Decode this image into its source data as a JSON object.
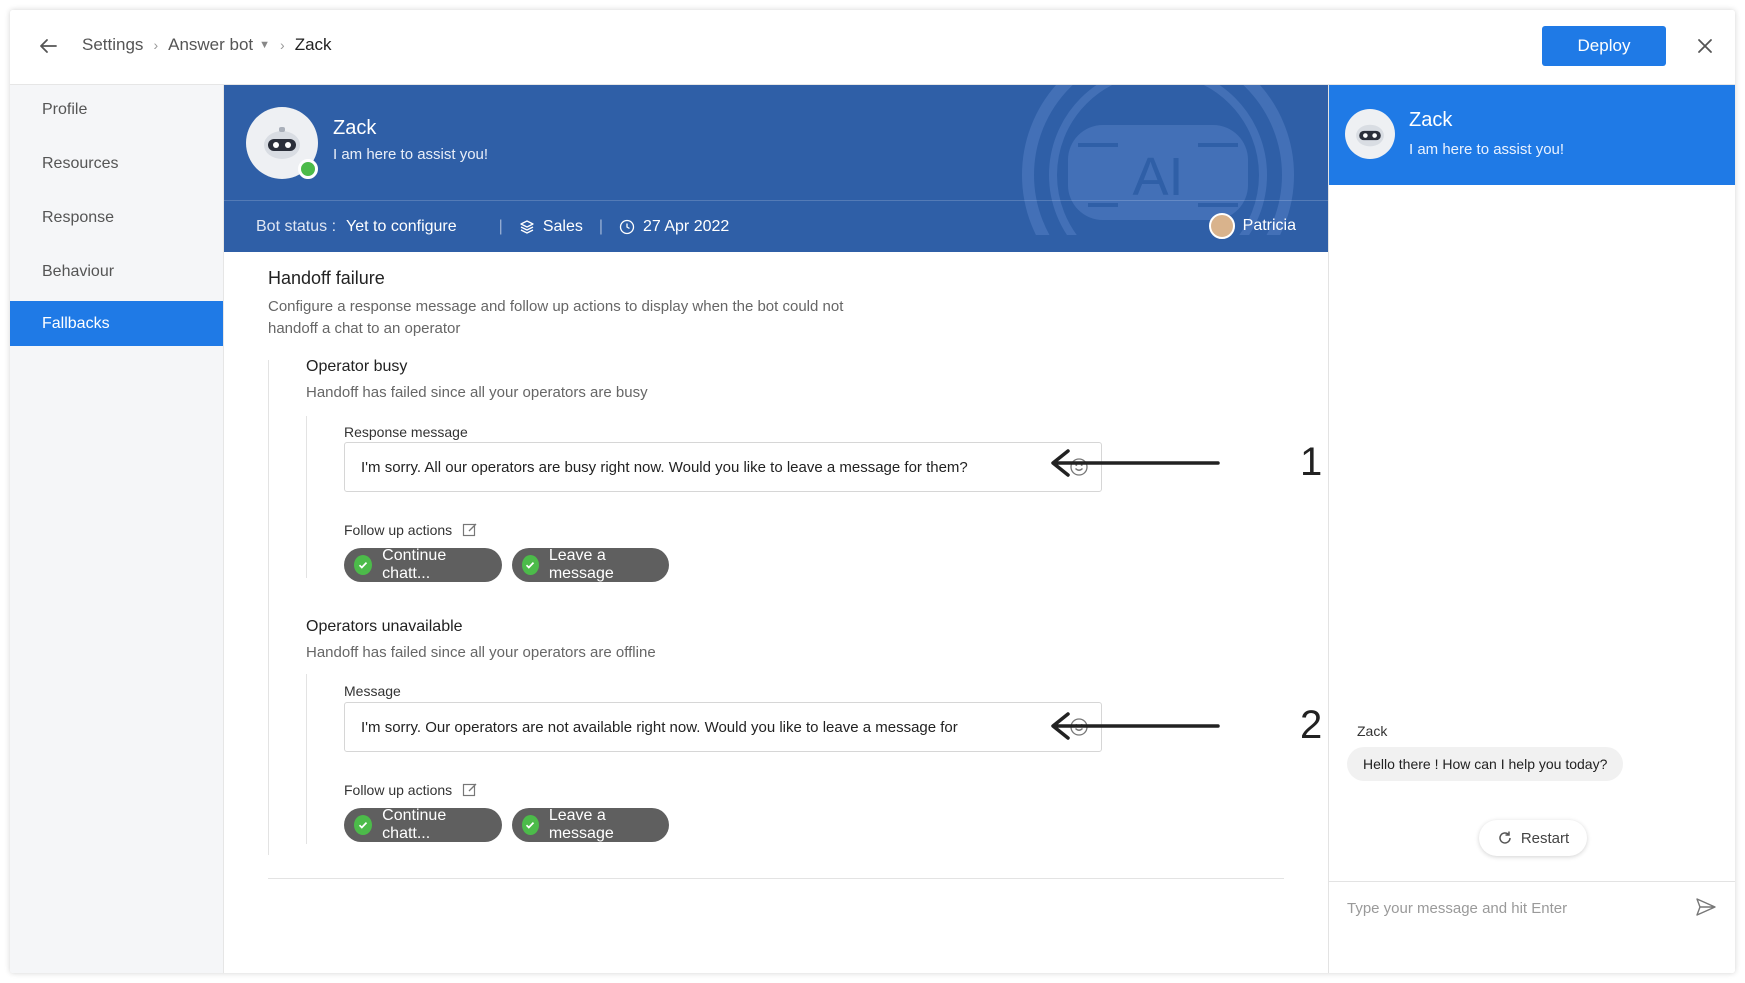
{
  "header": {
    "breadcrumb": [
      "Settings",
      "Answer bot",
      "Zack"
    ],
    "deploy_label": "Deploy"
  },
  "sidebar": {
    "items": [
      {
        "label": "Profile"
      },
      {
        "label": "Resources"
      },
      {
        "label": "Response"
      },
      {
        "label": "Behaviour"
      },
      {
        "label": "Fallbacks",
        "active": true
      }
    ]
  },
  "banner": {
    "bot_name": "Zack",
    "tagline": "I am here to assist you!",
    "status_label": "Bot status :",
    "status_value": "Yet to configure",
    "department": "Sales",
    "date": "27 Apr 2022",
    "owner": "Patricia",
    "watermark_text": "AI"
  },
  "handoff": {
    "title": "Handoff failure",
    "description": "Configure a response message and follow up actions to display when the bot could not handoff a chat to an operator",
    "busy": {
      "title": "Operator busy",
      "description": "Handoff has failed since all your operators are busy",
      "field_label": "Response message",
      "message": "I'm sorry. All our operators are busy right now. Would you like to leave a message for them?",
      "follow_label": "Follow up actions",
      "actions": [
        "Continue chatt...",
        "Leave a message"
      ]
    },
    "unavailable": {
      "title": "Operators unavailable",
      "description": "Handoff has failed since all your operators are offline",
      "field_label": "Message",
      "message": "I'm sorry. Our operators are not available right now. Would you like to leave a message for",
      "follow_label": "Follow up actions",
      "actions": [
        "Continue chatt...",
        "Leave a message"
      ]
    }
  },
  "annotations": {
    "first": "1",
    "second": "2"
  },
  "preview": {
    "bot_name": "Zack",
    "tagline": "I am here to assist you!",
    "sender": "Zack",
    "greeting": "Hello there ! How can I help you today?",
    "restart_label": "Restart",
    "input_placeholder": "Type your message and hit Enter"
  },
  "colors": {
    "accent": "#1f7ae6",
    "banner": "#2f5fa7",
    "online": "#4cbb4a",
    "chip": "#5f5f5f"
  }
}
